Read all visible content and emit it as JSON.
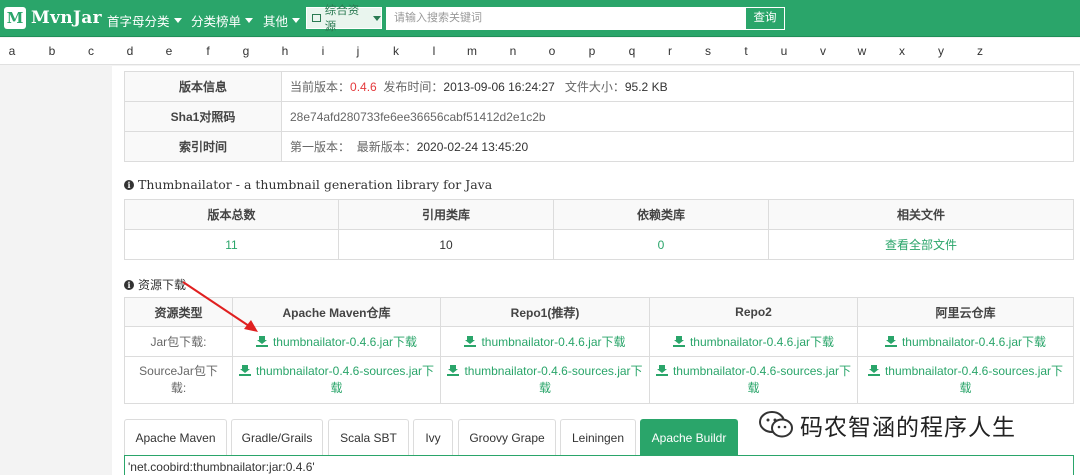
{
  "header": {
    "logo_mark": "M",
    "logo_text": "MvnJar",
    "nav": [
      {
        "label": "首字母分类"
      },
      {
        "label": "分类榜单"
      },
      {
        "label": "其他"
      }
    ],
    "resource_select": "综合资源",
    "search_placeholder": "请输入搜索关键词",
    "search_button": "查询"
  },
  "letters": [
    "a",
    "b",
    "c",
    "d",
    "e",
    "f",
    "g",
    "h",
    "i",
    "j",
    "k",
    "l",
    "m",
    "n",
    "o",
    "p",
    "q",
    "r",
    "s",
    "t",
    "u",
    "v",
    "w",
    "x",
    "y",
    "z"
  ],
  "info": {
    "version_label": "版本信息",
    "current_version_label": "当前版本：",
    "current_version": "0.4.6",
    "release_time_label": "发布时间：",
    "release_time": "2013-09-06 16:24:27",
    "file_size_label": "文件大小：",
    "file_size": "95.2 KB",
    "sha1_label": "Sha1对照码",
    "sha1": "28e74afd280733fe6ee36656cabf51412d2e1c2b",
    "index_time_label": "索引时间",
    "first_version_label": "第一版本：",
    "latest_version_label": "最新版本：",
    "latest_version_time": "2020-02-24 13:45:20"
  },
  "library_title": "Thumbnailator - a thumbnail generation library for Java",
  "stats": {
    "headers": [
      "版本总数",
      "引用类库",
      "依赖类库",
      "相关文件"
    ],
    "values": [
      "11",
      "10",
      "0",
      "查看全部文件"
    ]
  },
  "downloads": {
    "title": "资源下载",
    "headers": [
      "资源类型",
      "Apache Maven仓库",
      "Repo1(推荐)",
      "Repo2",
      "阿里云仓库"
    ],
    "jar_label": "Jar包下载:",
    "jar_link": "thumbnailator-0.4.6.jar下载",
    "source_label": "SourceJar包下载:",
    "source_link": "thumbnailator-0.4.6-sources.jar下载"
  },
  "tabs": [
    "Apache Maven",
    "Gradle/Grails",
    "Scala SBT",
    "Ivy",
    "Groovy Grape",
    "Leiningen",
    "Apache Buildr"
  ],
  "active_tab": "Apache Buildr",
  "code_snippet": "'net.coobird:thumbnailator:jar:0.4.6'",
  "watermark": "码农智涵的程序人生",
  "colors": {
    "brand": "#2aa56a",
    "highlight": "#e4393c",
    "arrow": "#e02020"
  }
}
